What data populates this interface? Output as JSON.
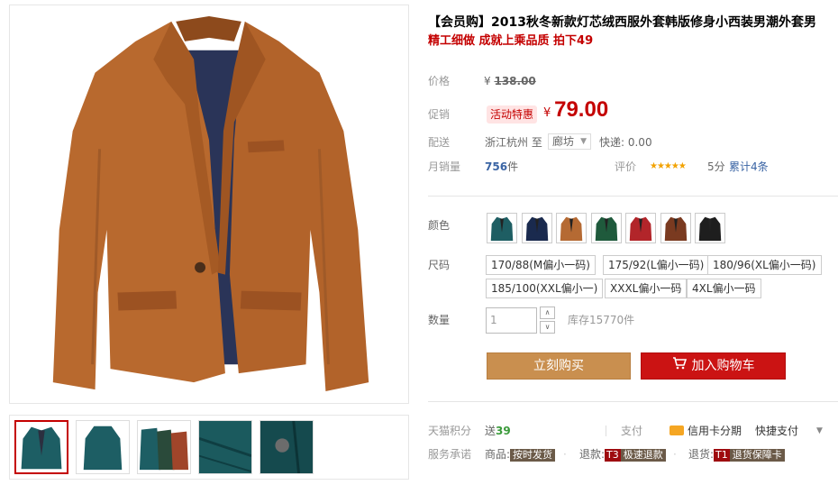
{
  "product": {
    "title": "【会员购】2013秋冬新款灯芯绒西服外套韩版修身小西装男潮外套男",
    "subtitle": "精工细做 成就上乘品质 拍下49",
    "image_alt": "orange blazer jacket",
    "main_color": "#b8692e"
  },
  "price": {
    "label": "价格",
    "currency": "¥",
    "original": "138.00",
    "promo_label": "促销",
    "promo_badge": "活动特惠",
    "promo": "79.00"
  },
  "shipping": {
    "label": "配送",
    "from": "浙江杭州 至",
    "to": "廊坊",
    "fee": "快递: 0.00"
  },
  "sales": {
    "label": "月销量",
    "count": "756",
    "unit": "件",
    "rating_label": "评价",
    "stars": "★★★★★",
    "score": "5分",
    "reviews": "累计4条"
  },
  "color": {
    "label": "颜色",
    "swatches": [
      {
        "name": "teal",
        "hex": "#1e5e63"
      },
      {
        "name": "navy",
        "hex": "#1a2a4e"
      },
      {
        "name": "camel",
        "hex": "#b56a33"
      },
      {
        "name": "green",
        "hex": "#1f5a3c"
      },
      {
        "name": "red",
        "hex": "#b2252a"
      },
      {
        "name": "brown",
        "hex": "#7a3a20"
      },
      {
        "name": "black",
        "hex": "#1e1e1e"
      }
    ]
  },
  "size": {
    "label": "尺码",
    "options": [
      "170/88(M偏小一码)",
      "175/92(L偏小一码)",
      "180/96(XL偏小一码)",
      "185/100(XXL偏小一)",
      "XXXL偏小一码",
      "4XL偏小一码"
    ]
  },
  "quantity": {
    "label": "数量",
    "value": "1",
    "up": "∧",
    "down": "∨",
    "stock": "库存15770件"
  },
  "buttons": {
    "buy_now": "立刻购买",
    "add_cart": "加入购物车"
  },
  "footer": {
    "points_label": "天猫积分",
    "points_prefix": "送",
    "points_value": "39",
    "pay_label": "支付",
    "credit": "信用卡分期",
    "quickpay": "快捷支付",
    "dropdown": "▼",
    "service_label": "服务承诺",
    "svc1_prefix": "商品:",
    "svc1_tag": "按时发货",
    "svc2_prefix": "退款:",
    "svc2_t": "T3",
    "svc2_tag": "极速退款",
    "svc3_prefix": "退货:",
    "svc3_t": "T1",
    "svc3_tag": "退货保障卡",
    "dot": "·"
  },
  "thumbnails": [
    {
      "name": "front",
      "hex": "#1d5e64"
    },
    {
      "name": "back",
      "hex": "#1d5e64"
    },
    {
      "name": "colors",
      "hex": "#1d5e64"
    },
    {
      "name": "fabric",
      "hex": "#1b5a5e"
    },
    {
      "name": "button",
      "hex": "#154a4e"
    }
  ]
}
